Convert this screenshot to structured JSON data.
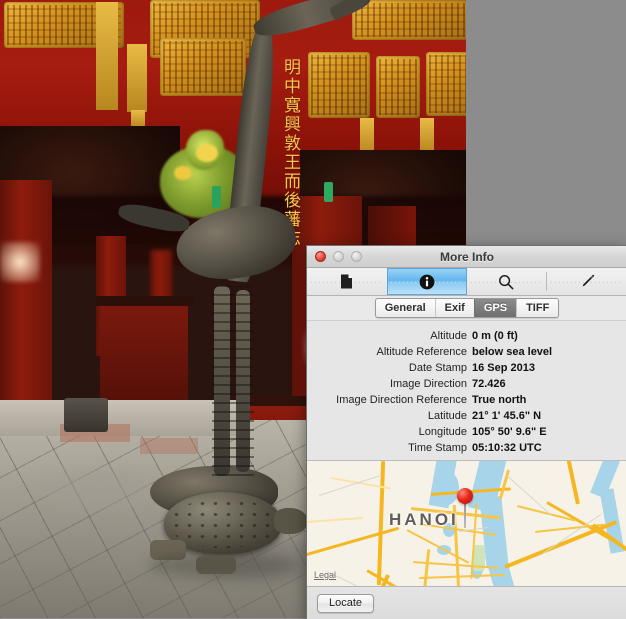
{
  "window": {
    "title": "More Info",
    "traffic_lights": [
      "close",
      "minimize",
      "zoom"
    ]
  },
  "toolbar": {
    "items": [
      {
        "name": "document-icon",
        "label": "Document",
        "selected": false
      },
      {
        "name": "info-icon",
        "label": "Info",
        "selected": true
      },
      {
        "name": "search-icon",
        "label": "Search",
        "selected": false
      },
      {
        "name": "pencil-icon",
        "label": "Annotate",
        "selected": false
      }
    ]
  },
  "tabs": [
    {
      "label": "General",
      "active": false
    },
    {
      "label": "Exif",
      "active": false
    },
    {
      "label": "GPS",
      "active": true
    },
    {
      "label": "TIFF",
      "active": false
    }
  ],
  "metadata": {
    "rows": [
      {
        "label": "Altitude",
        "value": "0 m (0 ft)"
      },
      {
        "label": "Altitude Reference",
        "value": "below sea level"
      },
      {
        "label": "Date Stamp",
        "value": "16 Sep 2013"
      },
      {
        "label": "Image Direction",
        "value": "72.426"
      },
      {
        "label": "Image Direction Reference",
        "value": "True north"
      },
      {
        "label": "Latitude",
        "value": "21° 1' 45.6\" N"
      },
      {
        "label": "Longitude",
        "value": "105° 50' 9.6\" E"
      },
      {
        "label": "Time Stamp",
        "value": "05:10:32 UTC"
      }
    ]
  },
  "map": {
    "city_label": "HANOI",
    "legal_label": "Legal",
    "pin_marker": "red-map-pin",
    "colors": {
      "land": "#f7f2e8",
      "water": "#a8d4ea",
      "road": "#f6c544",
      "road_major": "#f5b721",
      "pin": "#e8271a"
    }
  },
  "footer": {
    "locate_label": "Locate"
  },
  "photo": {
    "description": "Bronze crane standing on a turtle inside a red-and-gold Vietnamese temple hall",
    "background_color": "#8c8c8c"
  }
}
